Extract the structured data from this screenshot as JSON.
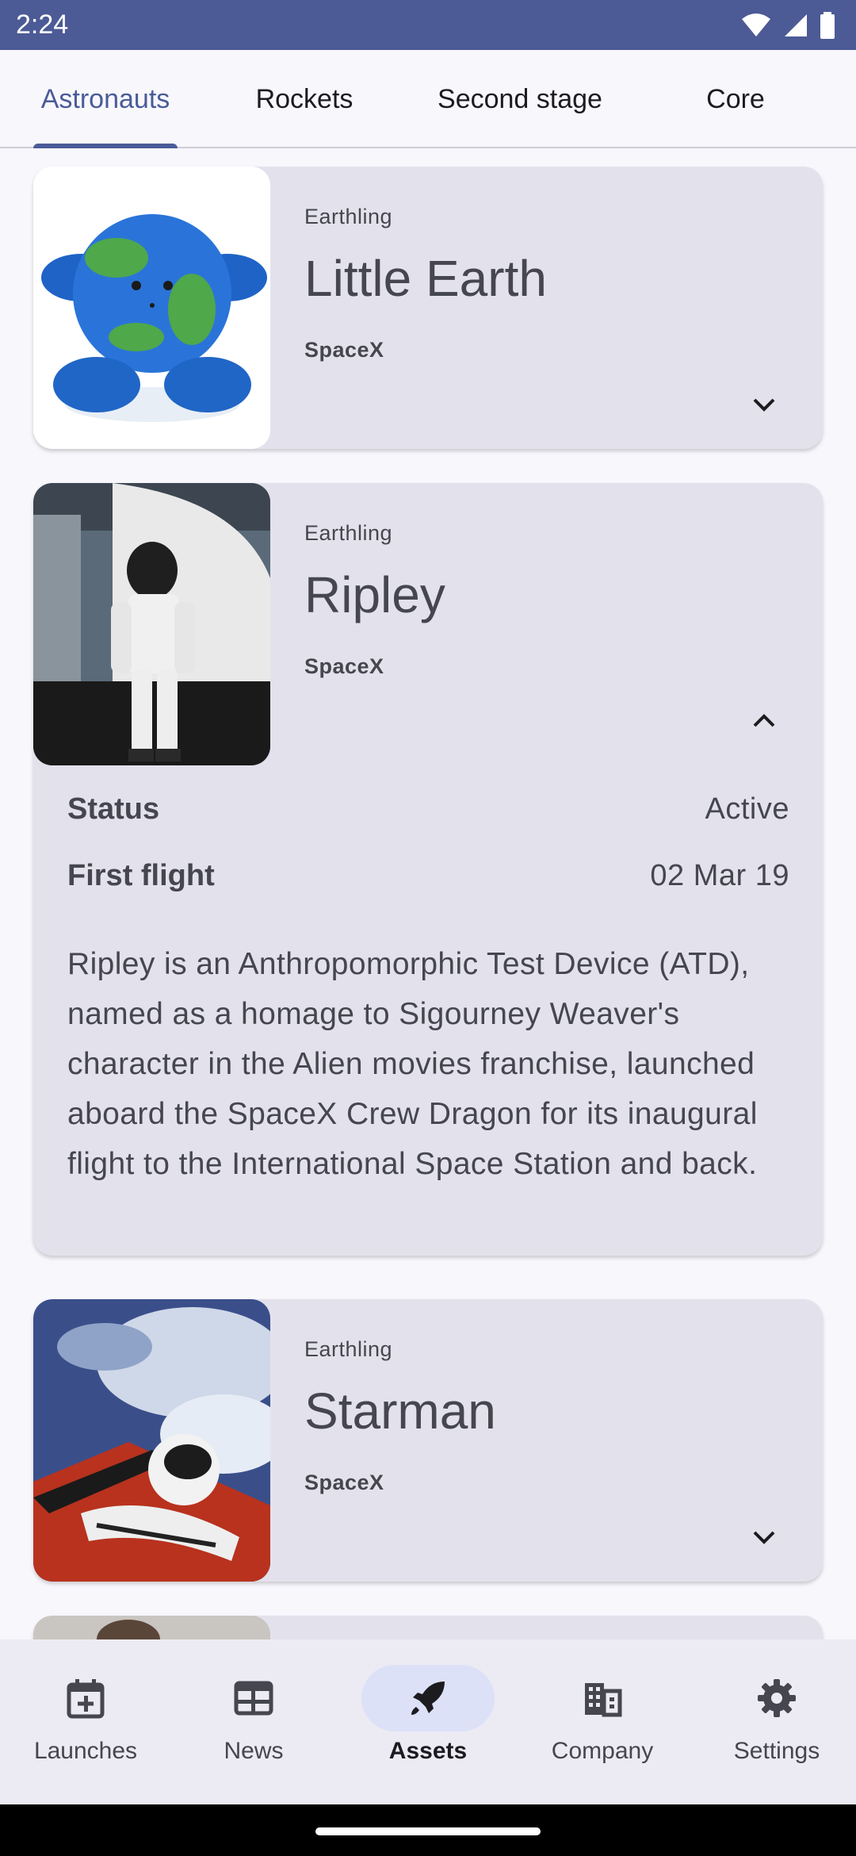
{
  "status_bar": {
    "time": "2:24"
  },
  "tabs": [
    {
      "label": "Astronauts",
      "active": true
    },
    {
      "label": "Rockets",
      "active": false
    },
    {
      "label": "Second stage",
      "active": false
    },
    {
      "label": "Core",
      "active": false
    }
  ],
  "cards": [
    {
      "type": "Earthling",
      "name": "Little Earth",
      "agency": "SpaceX",
      "expanded": false,
      "chevron": "chevron-down-icon"
    },
    {
      "type": "Earthling",
      "name": "Ripley",
      "agency": "SpaceX",
      "expanded": true,
      "chevron": "chevron-up-icon",
      "details": {
        "status_label": "Status",
        "status_value": "Active",
        "first_flight_label": "First flight",
        "first_flight_value": "02 Mar 19",
        "description": "Ripley is an Anthropomorphic Test Device (ATD), named as a homage to Sigourney Weaver's character in the Alien movies franchise, launched aboard the SpaceX Crew Dragon for its inaugural flight to the International Space Station and back."
      }
    },
    {
      "type": "Earthling",
      "name": "Starman",
      "agency": "SpaceX",
      "expanded": false,
      "chevron": "chevron-down-icon"
    }
  ],
  "bottom_nav": [
    {
      "label": "Launches",
      "icon": "calendar-add-icon",
      "active": false
    },
    {
      "label": "News",
      "icon": "news-icon",
      "active": false
    },
    {
      "label": "Assets",
      "icon": "rocket-icon",
      "active": true
    },
    {
      "label": "Company",
      "icon": "company-icon",
      "active": false
    },
    {
      "label": "Settings",
      "icon": "gear-icon",
      "active": false
    }
  ],
  "colors": {
    "status_bar": "#4c5a96",
    "accent": "#4a5b98",
    "card_bg": "#e3e2ec",
    "nav_active_pill": "#dde1f8"
  }
}
